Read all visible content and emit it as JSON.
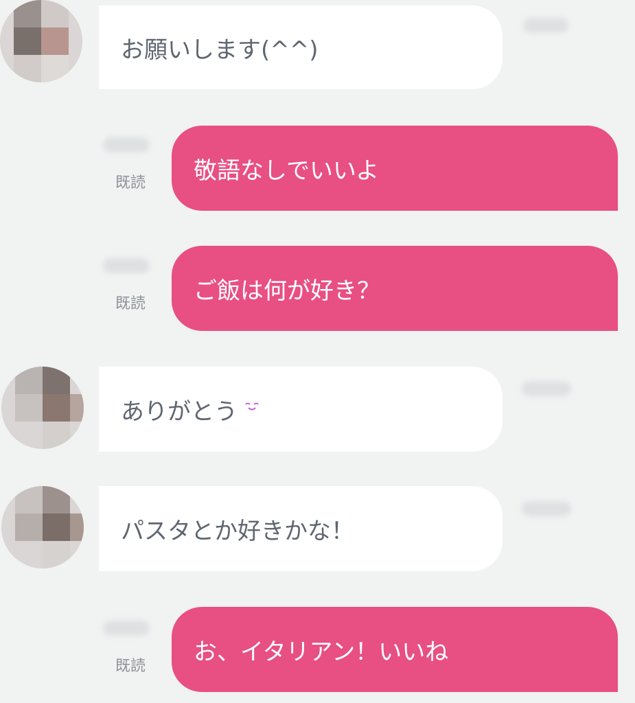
{
  "chat": {
    "colors": {
      "background": "#f1f2f2",
      "incoming_bubble": "#ffffff",
      "incoming_text": "#5f6670",
      "outgoing_bubble": "#e84f82",
      "outgoing_text": "#ffffff",
      "read_label": "#8d9399"
    },
    "messages": [
      {
        "direction": "incoming",
        "text": "お願いします(^^)"
      },
      {
        "direction": "outgoing",
        "text": "敬語なしでいいよ",
        "status": "既読"
      },
      {
        "direction": "outgoing",
        "text": "ご飯は何が好き？",
        "status": "既読"
      },
      {
        "direction": "incoming",
        "text": "ありがとう",
        "emoji": "smile-emoji"
      },
      {
        "direction": "incoming",
        "text": "パスタとか好きかな！"
      },
      {
        "direction": "outgoing",
        "text": "お、イタリアン！いいね",
        "status": "既読"
      }
    ]
  }
}
